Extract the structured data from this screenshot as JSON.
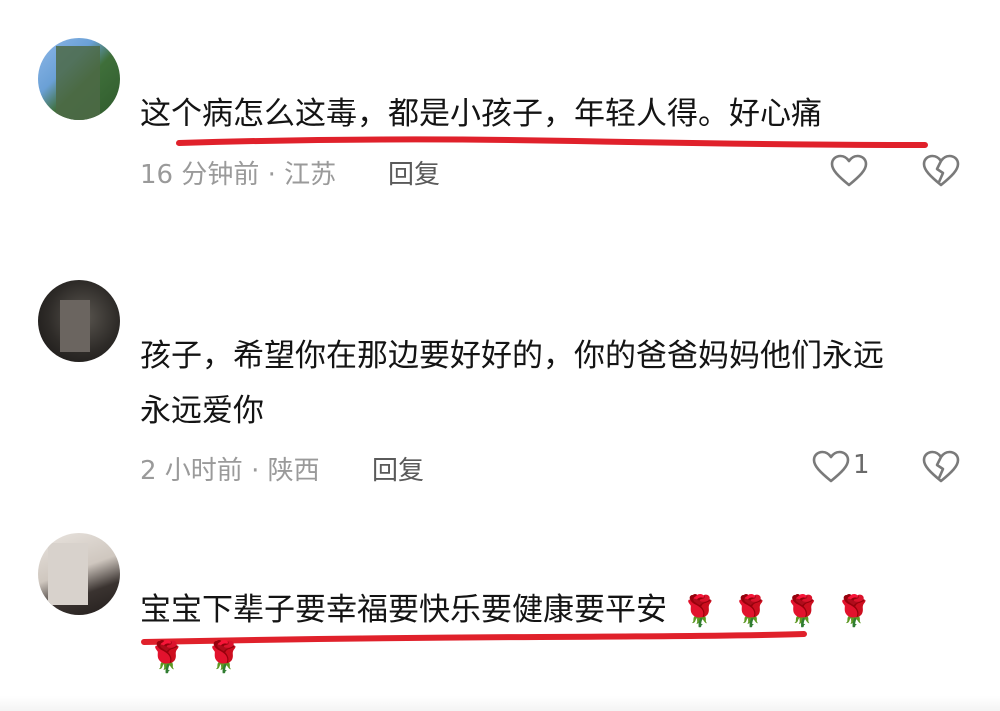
{
  "comments": [
    {
      "username": "",
      "text_line1": "这个病怎么这毒，都是小孩子，年轻人得。好心痛",
      "time_location": "16 分钟前 · 江苏",
      "reply_label": "回复",
      "like_count": ""
    },
    {
      "username": "",
      "text_line1": "孩子，希望你在那边要好好的，你的爸爸妈妈他们永远",
      "text_line2": "永远爱你",
      "time_location": "2 小时前 · 陕西",
      "reply_label": "回复",
      "like_count": "1"
    },
    {
      "username": "",
      "text_line1": "宝宝下辈子要幸福要快乐要健康要平安",
      "emoji": "🌹",
      "time_location": "",
      "reply_label": "",
      "like_count": ""
    }
  ],
  "icons": {
    "like": "heart-outline-icon",
    "dislike": "broken-heart-icon",
    "rose": "rose-emoji"
  },
  "colors": {
    "highlight_underline": "#e0212b",
    "meta_text": "#9a9a9a",
    "reply_text": "#5a5a5a"
  }
}
